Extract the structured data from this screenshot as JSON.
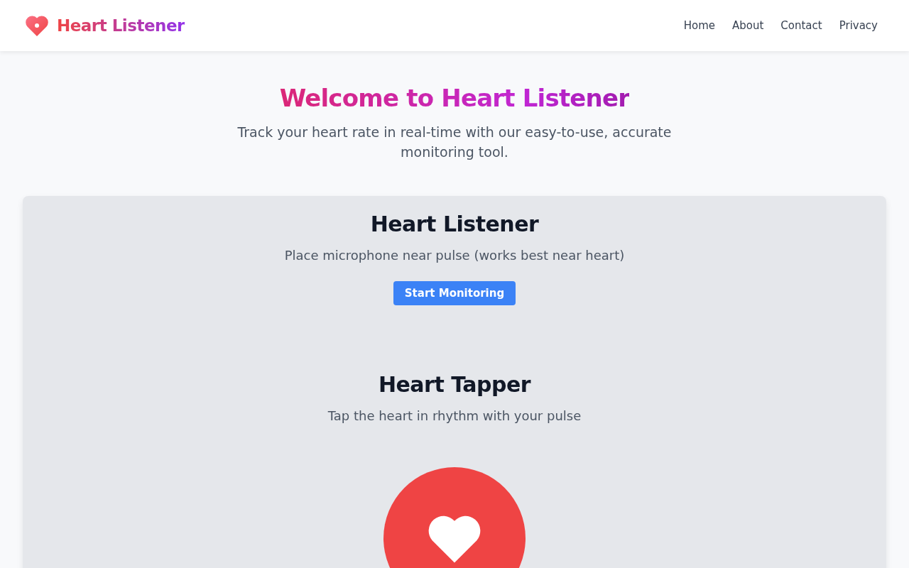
{
  "brand": {
    "name": "Heart Listener"
  },
  "nav": [
    {
      "label": "Home"
    },
    {
      "label": "About"
    },
    {
      "label": "Contact"
    },
    {
      "label": "Privacy"
    }
  ],
  "hero": {
    "title": "Welcome to Heart Listener",
    "subtitle": "Track your heart rate in real-time with our easy-to-use, accurate monitoring tool."
  },
  "listener": {
    "title": "Heart Listener",
    "hint": "Place microphone near pulse (works best near heart)",
    "button": "Start Monitoring"
  },
  "tapper": {
    "title": "Heart Tapper",
    "hint": "Tap the heart in rhythm with your pulse"
  }
}
